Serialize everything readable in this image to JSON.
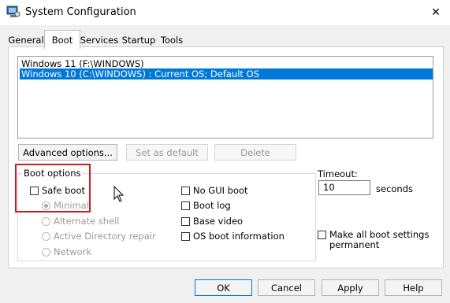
{
  "window": {
    "title": "System Configuration",
    "icon": "system-config-icon",
    "close_glyph": "✕"
  },
  "tabs": [
    {
      "label": "General",
      "active": false
    },
    {
      "label": "Boot",
      "active": true
    },
    {
      "label": "Services",
      "active": false
    },
    {
      "label": "Startup",
      "active": false
    },
    {
      "label": "Tools",
      "active": false
    }
  ],
  "os_list": [
    {
      "label": "Windows 11 (F:\\WINDOWS)",
      "selected": false
    },
    {
      "label": "Windows 10 (C:\\WINDOWS) : Current OS; Default OS",
      "selected": true
    }
  ],
  "buttons": {
    "advanced_options": "Advanced options...",
    "set_as_default": "Set as default",
    "delete": "Delete",
    "ok": "OK",
    "cancel": "Cancel",
    "apply": "Apply",
    "help": "Help"
  },
  "boot_options": {
    "group_label": "Boot options",
    "safe_boot": {
      "label": "Safe boot",
      "checked": false
    },
    "radios": [
      "Minimal",
      "Alternate shell",
      "Active Directory repair",
      "Network"
    ],
    "right_checks": [
      {
        "label": "No GUI boot",
        "checked": false
      },
      {
        "label": "Boot log",
        "checked": false
      },
      {
        "label": "Base video",
        "checked": false
      },
      {
        "label": "OS boot information",
        "checked": false
      }
    ]
  },
  "timeout": {
    "label": "Timeout:",
    "value": "10",
    "unit": "seconds"
  },
  "permanent": {
    "label_line1": "Make all boot settings",
    "label_line2": "permanent",
    "checked": false
  },
  "colors": {
    "selection": "#0078d7",
    "highlight_box": "#d0181e"
  }
}
